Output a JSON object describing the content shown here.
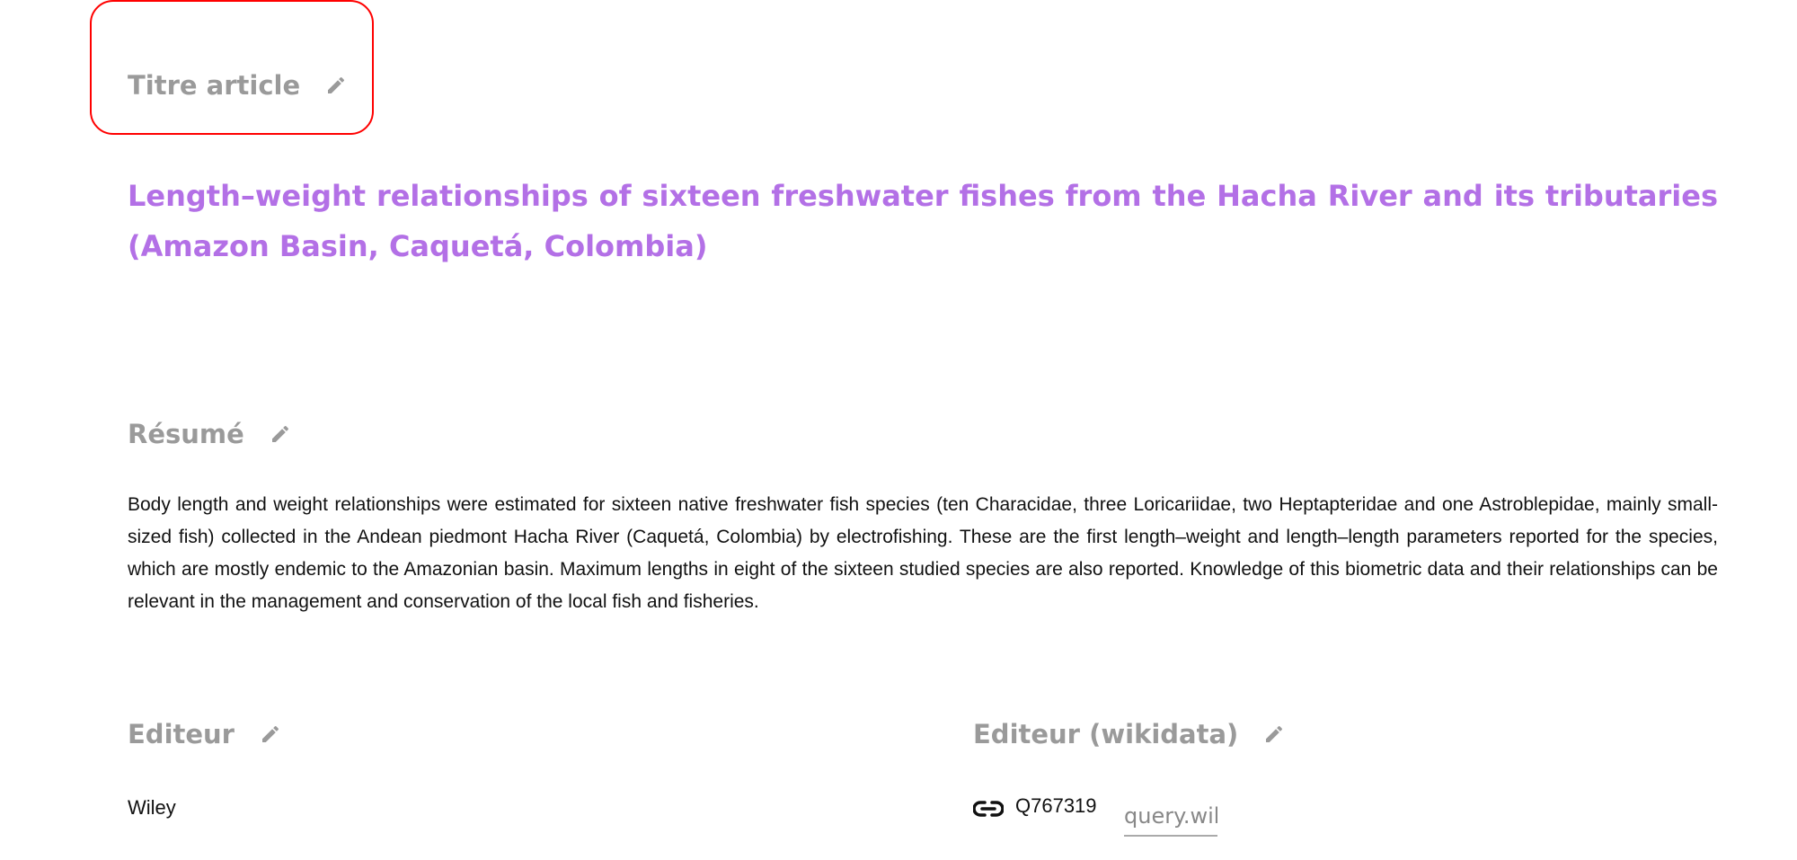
{
  "fields": {
    "title_label": "Titre article",
    "title_value": "Length–weight relationships of sixteen freshwater fishes from the Hacha River and its tributaries (Amazon Basin, Caquetá, Colombia)",
    "abstract_label": "Résumé",
    "abstract_value": "Body length and weight relationships were estimated for sixteen native freshwater fish species (ten Characidae, three Loricariidae, two Heptapteridae and one Astroblepidae, mainly small-sized fish) collected in the Andean piedmont Hacha River (Caquetá, Colombia) by electrofishing. These are the first length–weight and length–length parameters reported for the species, which are mostly endemic to the Amazonian basin. Maximum lengths in eight of the sixteen studied species are also reported. Knowledge of this biometric data and their relationships can be relevant in the management and conservation of the local fish and fisheries.",
    "publisher_label": "Editeur",
    "publisher_value": "Wiley",
    "publisher_wikidata_label": "Editeur (wikidata)",
    "publisher_wikidata_id": "Q767319",
    "query_input_value": "query.wikidata"
  },
  "colors": {
    "title": "#b370e6",
    "highlight": "#ff0000",
    "label": "#9a9a9a"
  }
}
